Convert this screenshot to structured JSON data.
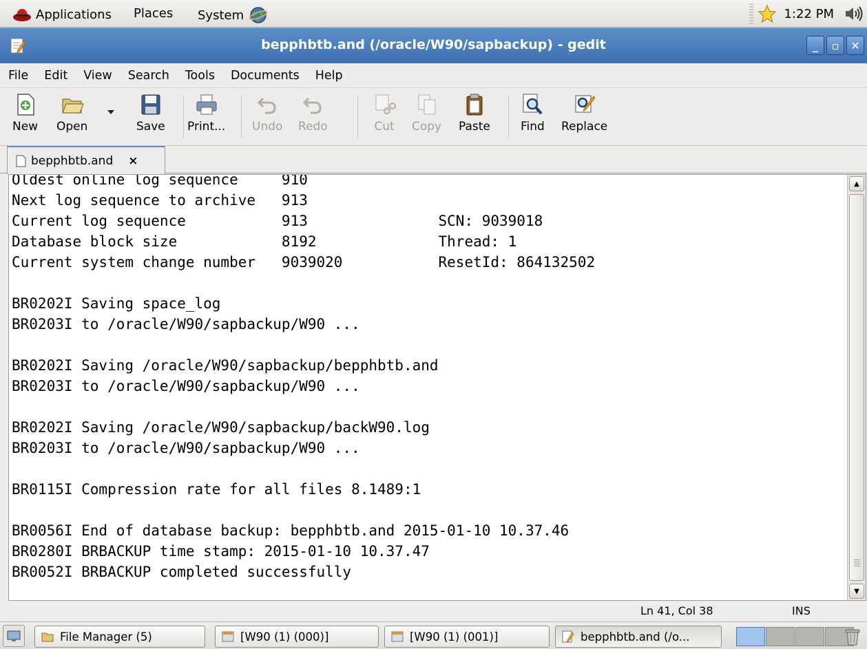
{
  "top_panel": {
    "applications_label": "Applications",
    "places_label": "Places",
    "system_label": "System",
    "clock": "1:22 PM"
  },
  "window": {
    "title": "bepphbtb.and (/oracle/W90/sapbackup) - gedit",
    "minimize": "_",
    "maximize": "▫",
    "close": "✕"
  },
  "menubar": {
    "items": [
      "File",
      "Edit",
      "View",
      "Search",
      "Tools",
      "Documents",
      "Help"
    ]
  },
  "toolbar": {
    "new_label": "New",
    "open_label": "Open",
    "save_label": "Save",
    "print_label": "Print...",
    "undo_label": "Undo",
    "redo_label": "Redo",
    "cut_label": "Cut",
    "copy_label": "Copy",
    "paste_label": "Paste",
    "find_label": "Find",
    "replace_label": "Replace"
  },
  "tab": {
    "label": "bepphbtb.and",
    "close": "×"
  },
  "editor": {
    "lines": [
      "Oldest online log sequence     910",
      "Next log sequence to archive   913",
      "Current log sequence           913               SCN: 9039018",
      "Database block size            8192              Thread: 1",
      "Current system change number   9039020           ResetId: 864132502",
      "",
      "BR0202I Saving space_log",
      "BR0203I to /oracle/W90/sapbackup/W90 ...",
      "",
      "BR0202I Saving /oracle/W90/sapbackup/bepphbtb.and",
      "BR0203I to /oracle/W90/sapbackup/W90 ...",
      "",
      "BR0202I Saving /oracle/W90/sapbackup/backW90.log",
      "BR0203I to /oracle/W90/sapbackup/W90 ...",
      "",
      "BR0115I Compression rate for all files 8.1489:1",
      "",
      "BR0056I End of database backup: bepphbtb.and 2015-01-10 10.37.46",
      "BR0280I BRBACKUP time stamp: 2015-01-10 10.37.47",
      "BR0052I BRBACKUP completed successfully",
      ""
    ]
  },
  "statusbar": {
    "position": "Ln 41, Col 38",
    "mode": "INS"
  },
  "taskbar": {
    "tasks": [
      {
        "label": "File Manager (5)"
      },
      {
        "label": "[W90 (1) (000)]"
      },
      {
        "label": "[W90 (1) (001)]"
      },
      {
        "label": "bepphbtb.and (/o..."
      }
    ]
  }
}
